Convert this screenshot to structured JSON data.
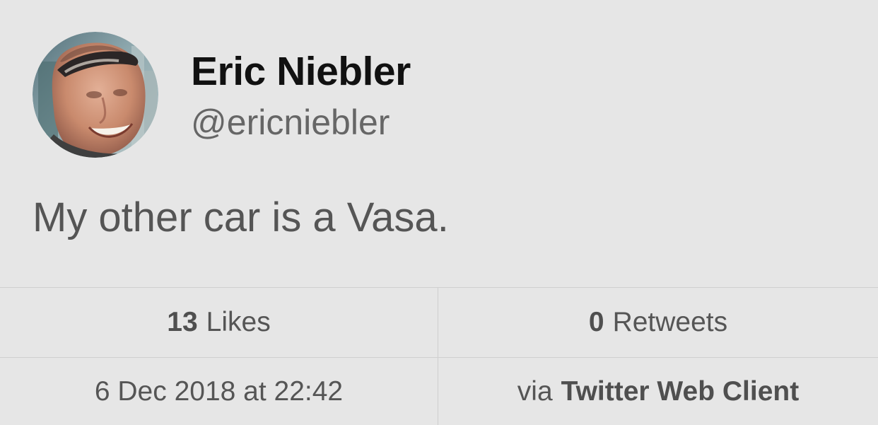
{
  "profile": {
    "display_name": "Eric Niebler",
    "username": "@ericniebler"
  },
  "tweet": {
    "text": "My other car is a Vasa."
  },
  "stats": {
    "likes_count": "13",
    "likes_label": "Likes",
    "retweets_count": "0",
    "retweets_label": "Retweets",
    "timestamp": "6 Dec 2018 at 22:42",
    "via_prefix": "via",
    "client_name": "Twitter Web Client"
  },
  "colors": {
    "background": "#e6e6e6",
    "divider": "#cfcfcf",
    "primary_text": "#111111",
    "secondary_text": "#555555"
  },
  "icons": {
    "avatar": "user-avatar-photo"
  }
}
